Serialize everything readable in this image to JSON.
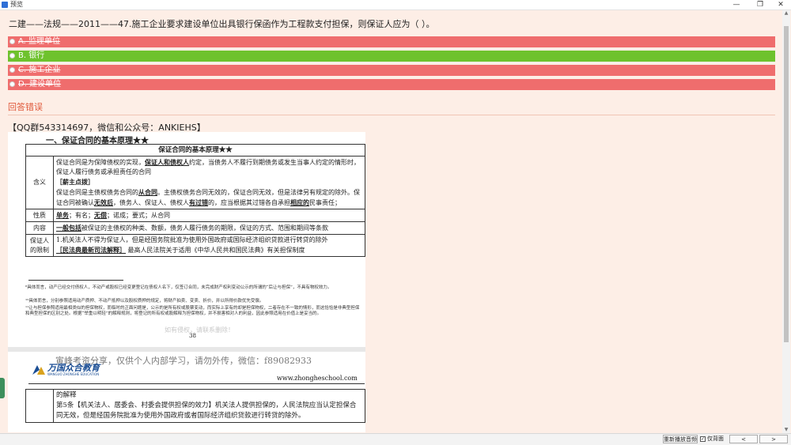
{
  "window": {
    "title": "预览"
  },
  "window_controls": {
    "minimize": "—",
    "maximize": "❐",
    "close": "✕"
  },
  "question": {
    "text": "二建——法规——2011——47.施工企业要求建设单位出具银行保函作为工程款支付担保，则保证人应为（ ）。"
  },
  "options": [
    {
      "label": "A. 监理单位",
      "state": "wrong"
    },
    {
      "label": "B. 银行",
      "state": "correct"
    },
    {
      "label": "C. 施工企业",
      "state": "wrong"
    },
    {
      "label": "D. 建设单位",
      "state": "wrong"
    }
  ],
  "result": {
    "text": "回答错误"
  },
  "contact": {
    "text": "【QQ群543314697，微信和公众号：ANKIEHS】"
  },
  "doc": {
    "section_heading": "一、保证合同的基本原理★★",
    "table_title": "保证合同的基本原理★★",
    "rows": {
      "meaning_label": "含义",
      "meaning_p1a": "保证合同是为保障债权的实现，",
      "meaning_p1u": "保证人和债权人",
      "meaning_p1b": "约定，当债务人不履行到期债务或发生当事人约定的情形时，保证人履行债务或承担责任的合同",
      "meaning_tip": "［薪主点拨］",
      "meaning_p2a": "保证合同是主债权债务合同的",
      "meaning_p2u1": "从合同",
      "meaning_p2b": "。主债权债务合同无效的，保证合同无效，但是法律另有规定的除外。保证合同被确认",
      "meaning_p2u2": "无效后",
      "meaning_p2c": "，债务人、保证人、债权人",
      "meaning_p2u3": "有过错",
      "meaning_p2d": "的，应当根据其过错各自承担",
      "meaning_p2u4": "相应的",
      "meaning_p2e": "民事责任；",
      "nature_label": "性质",
      "nature_u1": "单务",
      "nature_t1": "；有名；",
      "nature_u2": "无偿",
      "nature_t2": "；诺成；要式；从合同",
      "content_label": "内容",
      "content_u": "一般包括",
      "content_t": "被保证的主债权的种类、数额，债务人履行债务的期限，保证的方式、范围和期间等条款",
      "limit_label": "保证人的限制",
      "limit_t1": "1.机关法人不得为保证人，但是经国务院批准为使用外国政府或国际经济组织贷款进行转贷的除外",
      "limit_u": "［民法典最新司法解释］",
      "limit_t2": "最高人民法院关于适用《中华人民共和国民法典》有关担保制度"
    },
    "footnotes": [
      "⁸具体而言，动产已经交付债权人，不动产或股权已经变更登记在债权人名下，仅签订合同，未完成财产权利变动公示的所谓的“后让与担保”，不具有物权效力。",
      "¹⁰具体而言，分别参照适用动产质押、不动产抵押以及股权质押的规定，将财产拍卖、变卖、折价，并以所得价款优先受偿。",
      "¹¹让与担保参照适用最相类似的担保物权，而临时的正面问题是，公示的是所有权或股票变动，而实际上享有的却是担保物权，二者存在不一致的情形，而这恰恰是非典型担保和典型担保的区别之处。根据“举重以明轻”的解释规则，将登记的所有权或股解释为担保物权，并不损害相对人的利益，因此参照适用在价值上是妥当的。"
    ],
    "page_number": "38",
    "watermark": "如有侵权，请联系删除！",
    "share_line": "寅峰考资分享，仅供个人内部学习，请勿外传，微信：f89082933",
    "logo_name": "万国众合教育",
    "logo_sub": "WANGUO ZHONGHE EDUCATION",
    "site": "www.zhongheschool.com",
    "row2_t1": "的解释",
    "row2_t2": "第5条【机关法人、居委会、村委会提供担保的效力】机关法人提供担保的，人民法院应当认定担保合同无效，但是经国务院批准为使用外国政府或者国际经济组织贷款进行转贷的除外。"
  },
  "bottombar": {
    "btn_label": "重新播放音频",
    "check_label": "仅背面",
    "prev": "<",
    "next": ">"
  },
  "colors": {
    "wrong": "#ef6d6d",
    "correct": "#6ec22d",
    "background": "#fdeee6",
    "result": "#e05a3c"
  }
}
